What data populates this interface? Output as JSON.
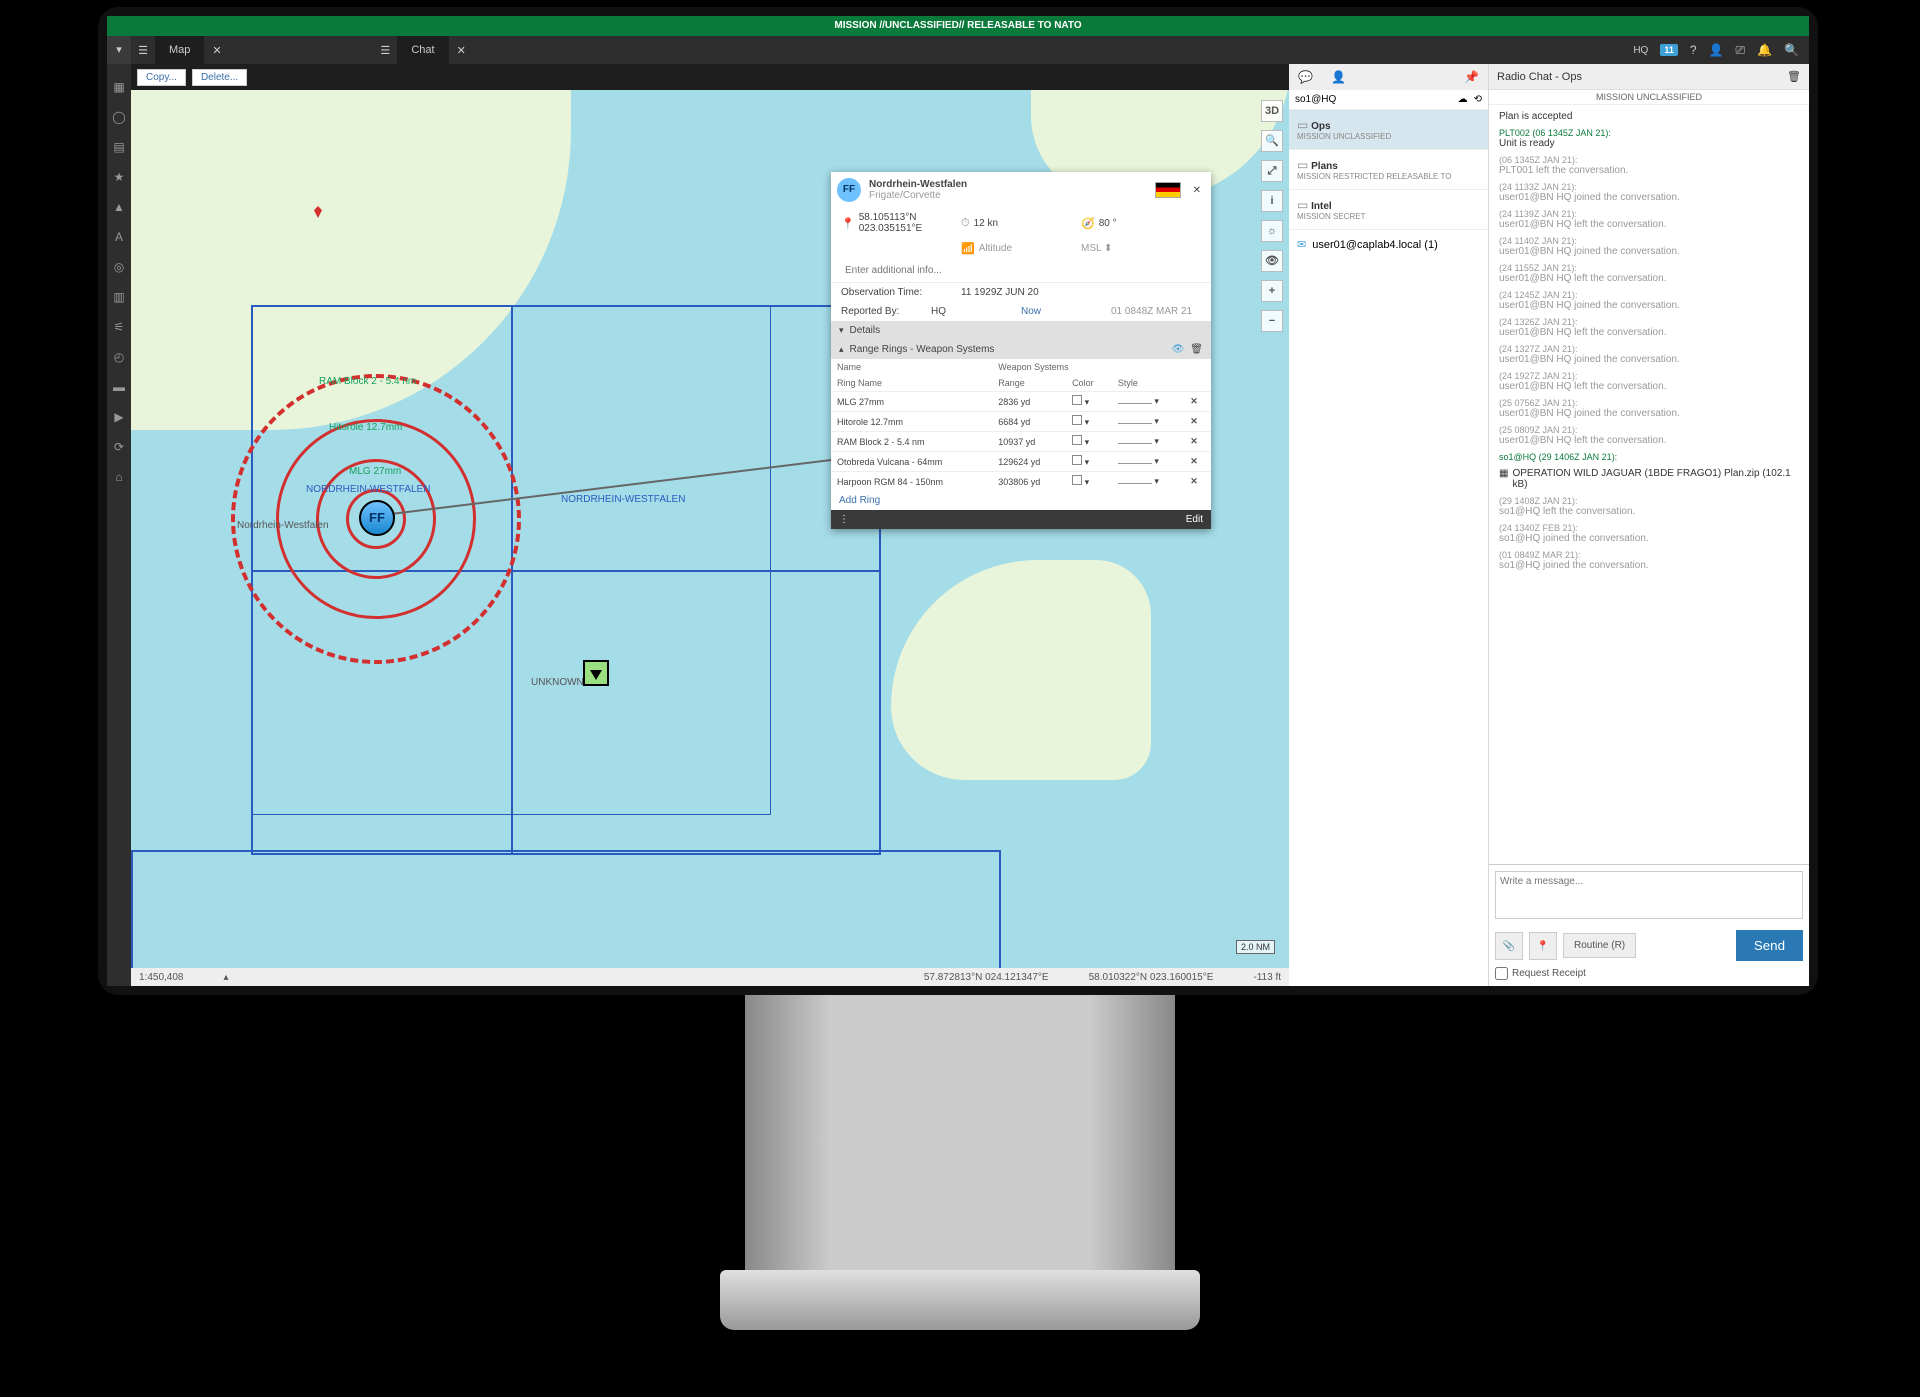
{
  "banner": "MISSION //UNCLASSIFIED// RELEASABLE TO NATO",
  "tabs": {
    "map": "Map",
    "chat": "Chat"
  },
  "topright": {
    "hq": "HQ",
    "badge": "11"
  },
  "map_toolbar": {
    "copy": "Copy...",
    "delete": "Delete..."
  },
  "map": {
    "labels": {
      "ram": "RAM Block 2 - 5.4 nm",
      "hitorole": "Hitorole 12.7mm",
      "mlg": "MLG 27mm",
      "ship_name": "NORDRHEIN-WESTFALEN",
      "ship_name_area": "NORDRHEIN-WESTFALEN",
      "ship_side": "Nordrhein-Westfalen",
      "unknown": "UNKNOWN",
      "scale": "2.0 NM",
      "ff": "FF"
    },
    "footer": {
      "ratio": "1:450,408",
      "coord1": "57.872813°N 024.121347°E",
      "coord2": "58.010322°N 023.160015°E",
      "alt": "-113 ft"
    }
  },
  "popup": {
    "title": "Nordrhein-Westfalen",
    "subtitle": "Frigate/Corvette",
    "coord": "58.105113°N 023.035151°E",
    "speed": "12 kn",
    "heading": "80 °",
    "alt_label": "Altitude",
    "msl": "MSL ⬍",
    "add_info_placeholder": "Enter additional info...",
    "obs_label": "Observation Time:",
    "obs_val": "11 1929Z JUN 20",
    "rep_label": "Reported By:",
    "rep_val": "HQ",
    "now": "Now",
    "now_ts": "01 0848Z MAR 21",
    "sect_details": "Details",
    "sect_rings": "Range Rings - Weapon Systems",
    "cols": {
      "name": "Name",
      "ws": "Weapon Systems",
      "ring": "Ring Name",
      "range": "Range",
      "color": "Color",
      "style": "Style"
    },
    "rows": [
      {
        "name": "MLG 27mm",
        "range": "2836 yd"
      },
      {
        "name": "Hitorole 12.7mm",
        "range": "6684 yd"
      },
      {
        "name": "RAM Block 2 - 5.4 nm",
        "range": "10937 yd"
      },
      {
        "name": "Otobreda Vulcana - 64mm",
        "range": "129624 yd"
      },
      {
        "name": "Harpoon RGM 84 - 150nm",
        "range": "303806 yd"
      }
    ],
    "add_ring": "Add Ring",
    "edit": "Edit"
  },
  "chat": {
    "hq_user": "so1@HQ",
    "rooms": [
      {
        "name": "Ops",
        "cls": "MISSION UNCLASSIFIED",
        "sel": true
      },
      {
        "name": "Plans",
        "cls": "MISSION RESTRICTED RELEASABLE TO"
      },
      {
        "name": "Intel",
        "cls": "MISSION SECRET"
      }
    ],
    "user_entry": "user01@caplab4.local (1)",
    "title": "Radio Chat - Ops",
    "classbar": "MISSION UNCLASSIFIED",
    "log": [
      {
        "type": "plain",
        "ts": "",
        "msg": "Plan is accepted"
      },
      {
        "type": "plt",
        "ts": "PLT002 (06 1345Z JAN 21):",
        "msg": "Unit is ready"
      },
      {
        "type": "sys",
        "ts": "(06 1345Z JAN 21):",
        "msg": "PLT001 left the conversation."
      },
      {
        "type": "sys",
        "ts": "(24 1133Z JAN 21):",
        "msg": "user01@BN HQ joined the conversation."
      },
      {
        "type": "sys",
        "ts": "(24 1139Z JAN 21):",
        "msg": "user01@BN HQ left the conversation."
      },
      {
        "type": "sys",
        "ts": "(24 1140Z JAN 21):",
        "msg": "user01@BN HQ joined the conversation."
      },
      {
        "type": "sys",
        "ts": "(24 1155Z JAN 21):",
        "msg": "user01@BN HQ left the conversation."
      },
      {
        "type": "sys",
        "ts": "(24 1245Z JAN 21):",
        "msg": "user01@BN HQ joined the conversation."
      },
      {
        "type": "sys",
        "ts": "(24 1326Z JAN 21):",
        "msg": "user01@BN HQ left the conversation."
      },
      {
        "type": "sys",
        "ts": "(24 1327Z JAN 21):",
        "msg": "user01@BN HQ joined the conversation."
      },
      {
        "type": "sys",
        "ts": "(24 1927Z JAN 21):",
        "msg": "user01@BN HQ left the conversation."
      },
      {
        "type": "sys",
        "ts": "(25 0756Z JAN 21):",
        "msg": "user01@BN HQ joined the conversation."
      },
      {
        "type": "sys",
        "ts": "(25 0809Z JAN 21):",
        "msg": "user01@BN HQ left the conversation."
      },
      {
        "type": "so1",
        "ts": "so1@HQ (29 1406Z JAN 21):",
        "msg": ""
      },
      {
        "type": "file",
        "ts": "",
        "msg": "OPERATION WILD JAGUAR (1BDE FRAGO1) Plan.zip (102.1 kB)"
      },
      {
        "type": "sys",
        "ts": "(29 1408Z JAN 21):",
        "msg": "so1@HQ left the conversation."
      },
      {
        "type": "sys",
        "ts": "(24 1340Z FEB 21):",
        "msg": "so1@HQ joined the conversation."
      },
      {
        "type": "sys",
        "ts": "(01 0849Z MAR 21):",
        "msg": "so1@HQ joined the conversation."
      }
    ],
    "compose_placeholder": "Write a message...",
    "priority": "Routine (R)",
    "receipt": "Request Receipt",
    "send": "Send"
  }
}
